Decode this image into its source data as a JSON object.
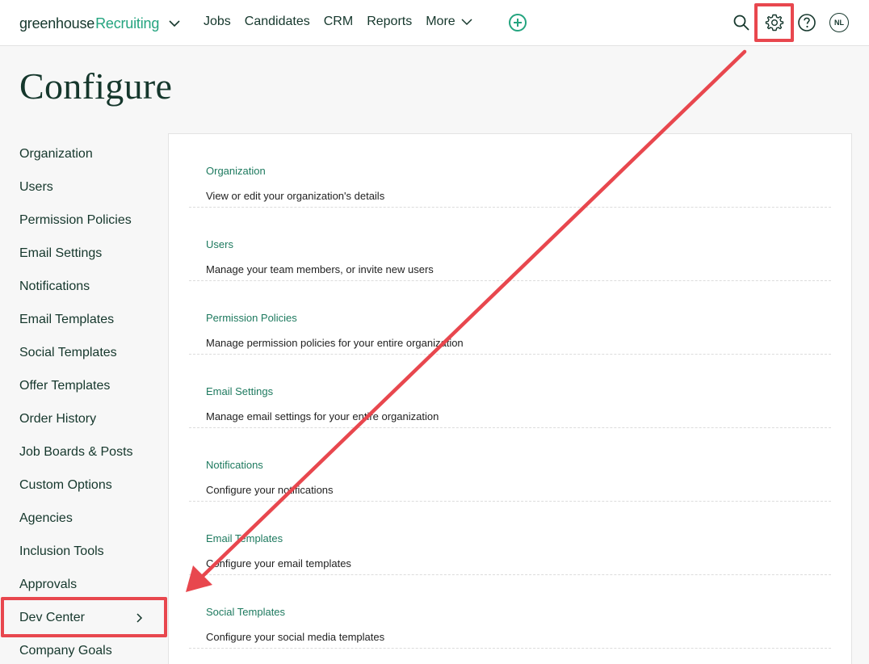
{
  "brand": {
    "part1": "greenhouse",
    "part2": "Recruiting"
  },
  "nav": {
    "links": [
      "Jobs",
      "Candidates",
      "CRM",
      "Reports"
    ],
    "more_label": "More"
  },
  "user": {
    "initials": "NL"
  },
  "page": {
    "title": "Configure"
  },
  "sidebar": {
    "items": [
      "Organization",
      "Users",
      "Permission Policies",
      "Email Settings",
      "Notifications",
      "Email Templates",
      "Social Templates",
      "Offer Templates",
      "Order History",
      "Job Boards & Posts",
      "Custom Options",
      "Agencies",
      "Inclusion Tools",
      "Approvals",
      "Dev Center",
      "Company Goals"
    ]
  },
  "sections": [
    {
      "title": "Organization",
      "description": "View or edit your organization's details"
    },
    {
      "title": "Users",
      "description": "Manage your team members, or invite new users"
    },
    {
      "title": "Permission Policies",
      "description": "Manage permission policies for your entire organization"
    },
    {
      "title": "Email Settings",
      "description": "Manage email settings for your entire organization"
    },
    {
      "title": "Notifications",
      "description": "Configure your notifications"
    },
    {
      "title": "Email Templates",
      "description": "Configure your email templates"
    },
    {
      "title": "Social Templates",
      "description": "Configure your social media templates"
    }
  ],
  "colors": {
    "brand_green": "#24a47f",
    "link_green": "#1e7a5f",
    "text_dark": "#15372c",
    "annotation_red": "#e8474e"
  },
  "icons": {
    "brand_dropdown": "chevron-down-icon",
    "more_dropdown": "chevron-down-icon",
    "add": "plus-circle-icon",
    "search": "search-icon",
    "settings": "gear-icon",
    "help": "question-circle-icon",
    "dev_center_expand": "chevron-right-icon"
  }
}
